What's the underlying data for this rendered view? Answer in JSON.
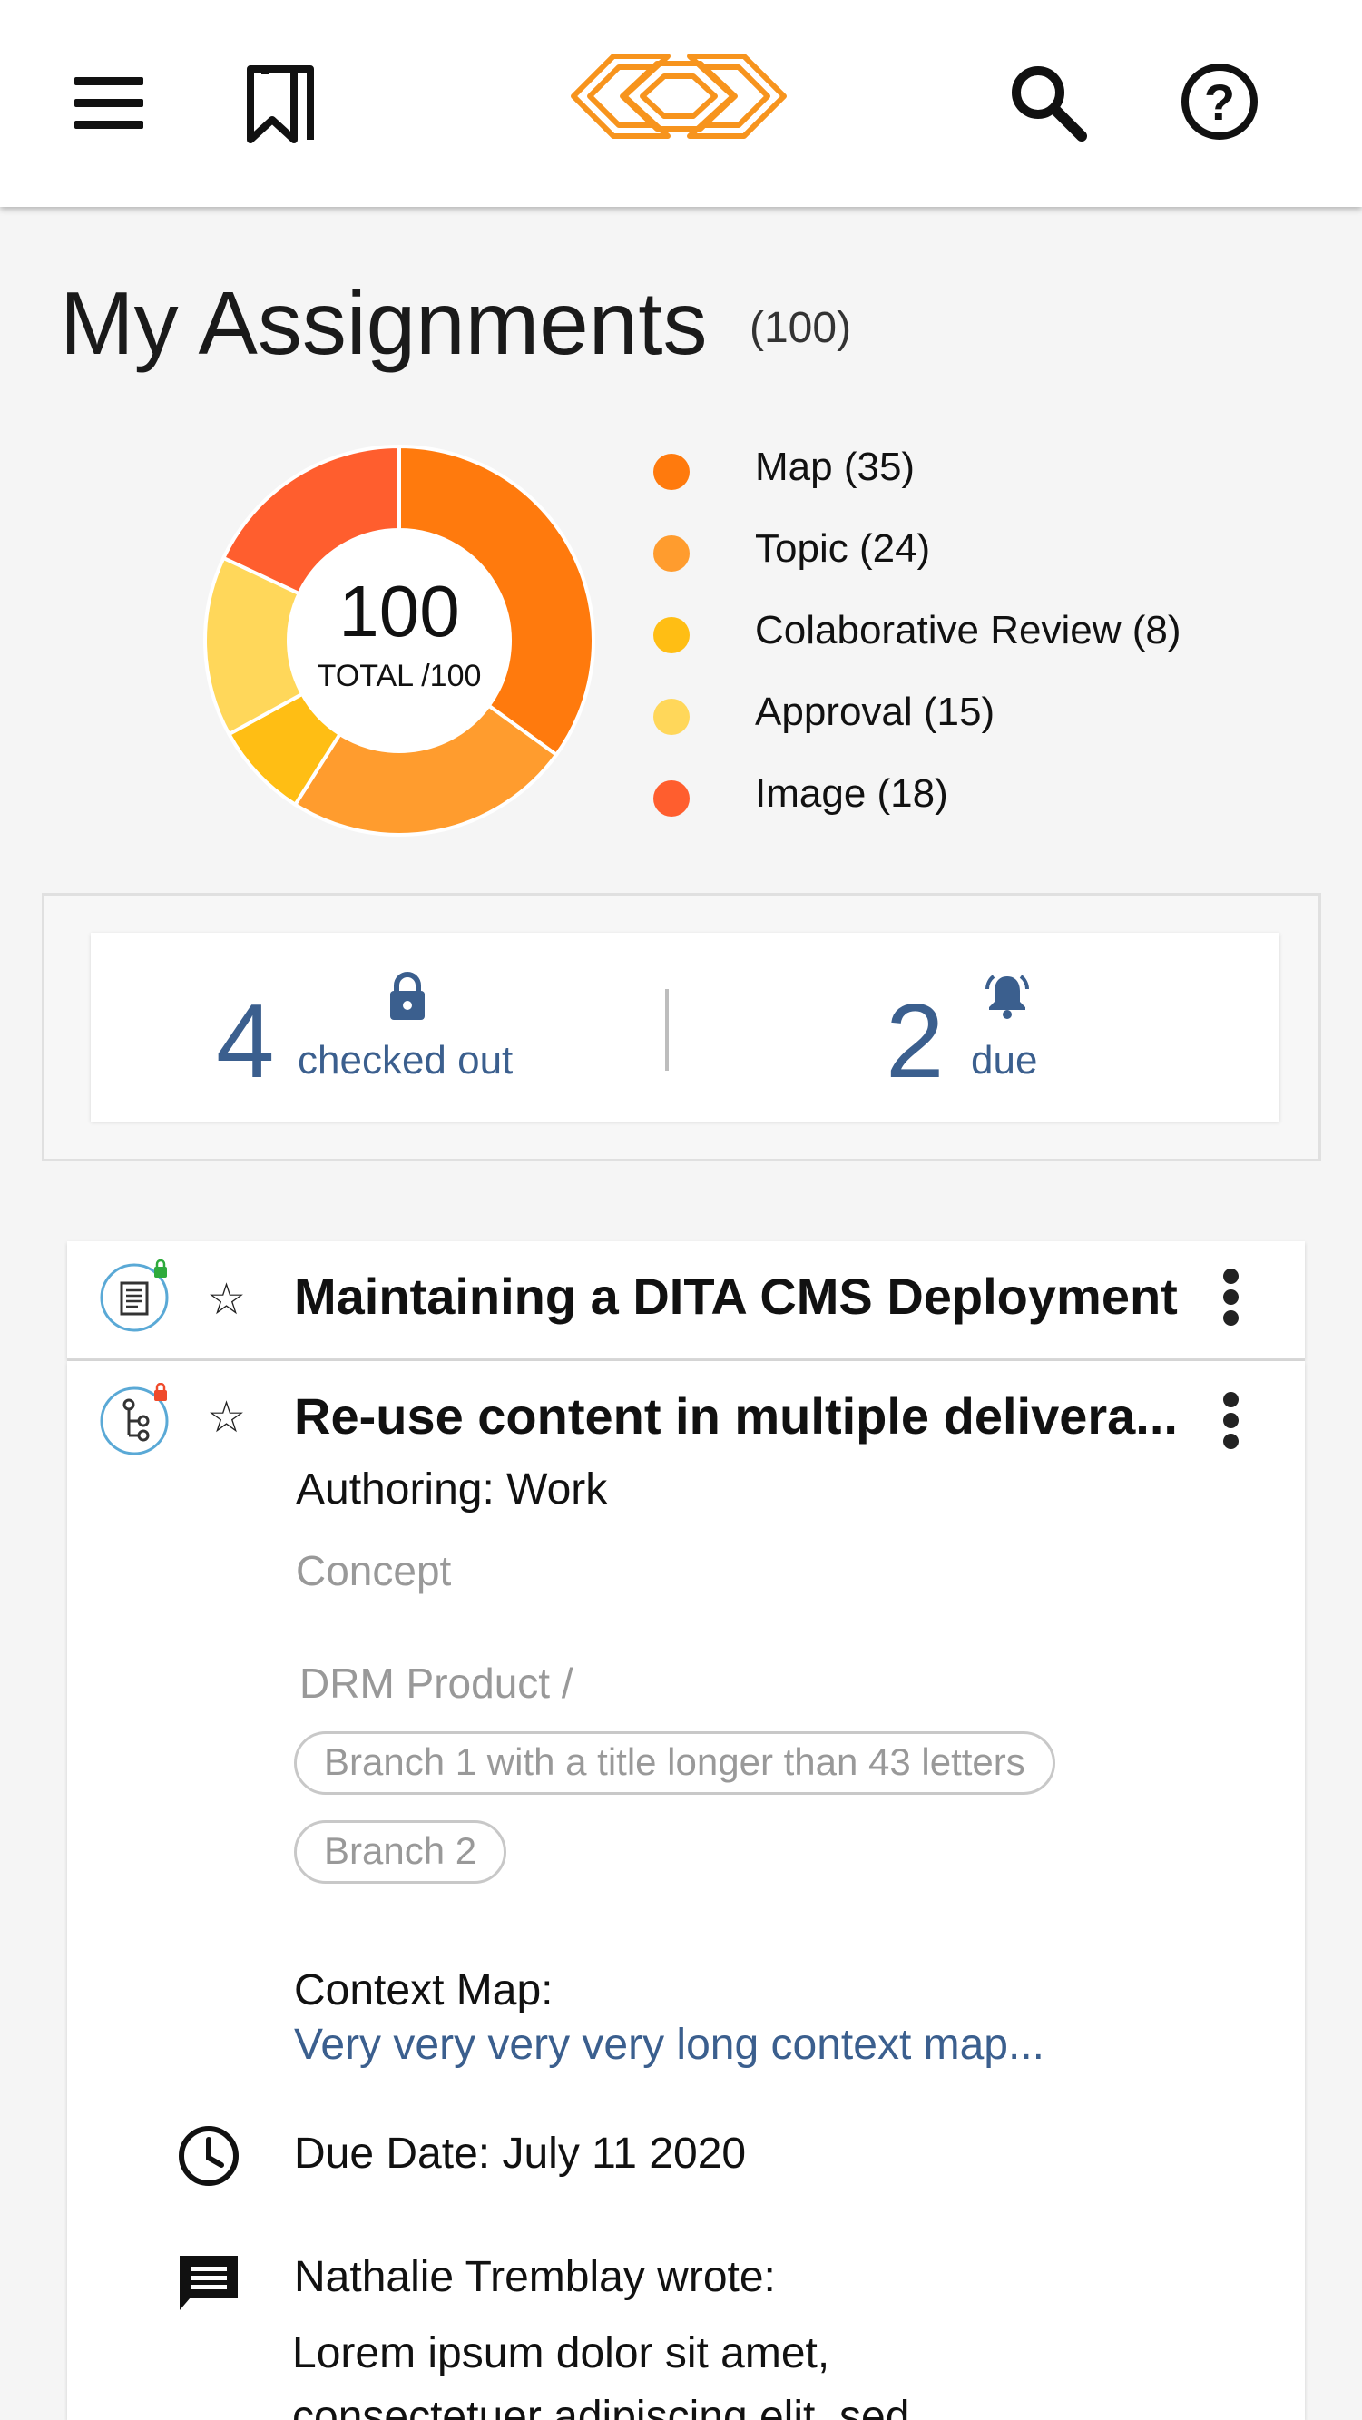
{
  "header": {
    "menu_icon": "menu-icon",
    "bookmarks_icon": "bookmarks-icon",
    "logo_icon": "logo-icon",
    "search_icon": "search-icon",
    "help_icon": "help-icon"
  },
  "title": "My Assignments",
  "count": "(100)",
  "chart_data": {
    "type": "pie",
    "center_value": "100",
    "center_label": "TOTAL /100",
    "slices": [
      {
        "label": "Map (35)",
        "value": 35,
        "color": "#FF7A0D"
      },
      {
        "label": "Topic (24)",
        "value": 24,
        "color": "#FF9C2E"
      },
      {
        "label": "Colaborative Review (8)",
        "value": 8,
        "color": "#FFBE14"
      },
      {
        "label": "Approval (15)",
        "value": 15,
        "color": "#FFD75A"
      },
      {
        "label": "Image (18)",
        "value": 18,
        "color": "#FF5E2E"
      }
    ]
  },
  "stats": {
    "checked_out_count": "4",
    "checked_out_label": "checked out",
    "due_count": "2",
    "due_label": "due"
  },
  "assignments": [
    {
      "title": "Maintaining a DITA CMS Deployment",
      "lock_color": "#2eaa3c"
    },
    {
      "title": "Re-use content in multiple delivera...",
      "lock_color": "#ef4a2b",
      "workflow": "Authoring: Work",
      "type": "Concept",
      "product": "DRM Product /",
      "branches": [
        "Branch 1 with a title longer than 43 letters",
        "Branch 2"
      ],
      "context_label": "Context Map:",
      "context_value": "Very very very very long context map...",
      "due_date": "Due Date: July 11 2020",
      "comment_author": "Nathalie Tremblay wrote:",
      "comment_text": "Lorem ipsum dolor sit amet,",
      "comment_text2": "consectetuer adipiscing elit, sed"
    }
  ],
  "colors": {
    "accent": "#F7941D",
    "link": "#3b5f8e"
  }
}
